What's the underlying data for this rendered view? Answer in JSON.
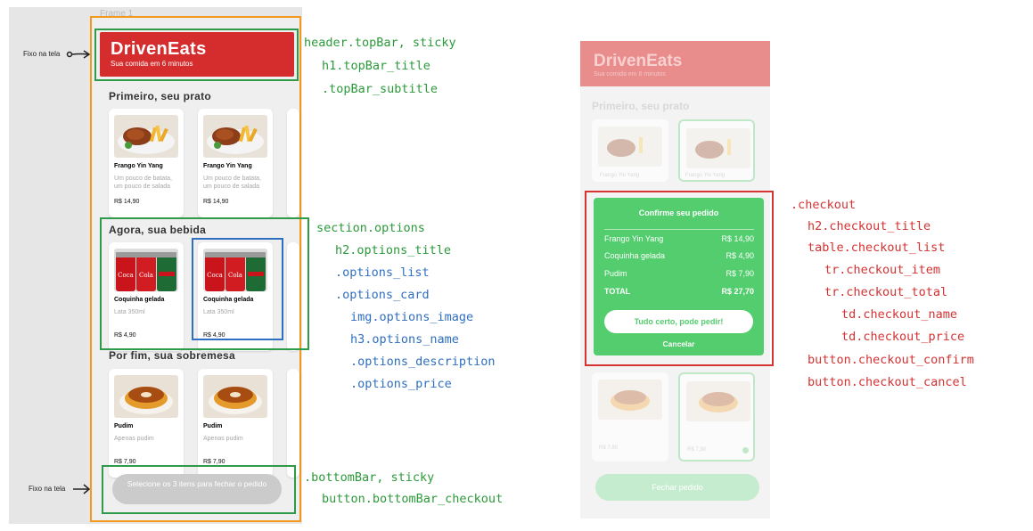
{
  "frame_label": "Frame 1",
  "pinned_label": "Fixo na tela",
  "app": {
    "title": "DrivenEats",
    "subtitle": "Sua comida em 6 minutos"
  },
  "sections": [
    {
      "title": "Primeiro, seu prato",
      "cards": [
        {
          "name": "Frango Yin Yang",
          "description": "Um pouco de batata, um pouco de salada",
          "price": "R$ 14,90",
          "image": "chicken-fries"
        },
        {
          "name": "Frango Yin Yang",
          "description": "Um pouco de batata, um pouco de salada",
          "price": "R$ 14,90",
          "image": "chicken-fries"
        }
      ]
    },
    {
      "title": "Agora, sua bebida",
      "cards": [
        {
          "name": "Coquinha gelada",
          "description": "Lata 350ml",
          "price": "R$ 4,90",
          "image": "cola-cans"
        },
        {
          "name": "Coquinha gelada",
          "description": "Lata 350ml",
          "price": "R$ 4,90",
          "image": "cola-cans"
        }
      ]
    },
    {
      "title": "Por fim, sua sobremesa",
      "cards": [
        {
          "name": "Pudim",
          "description": "Apenas pudim",
          "price": "R$ 7,90",
          "image": "flan"
        },
        {
          "name": "Pudim",
          "description": "Apenas pudim",
          "price": "R$ 7,90",
          "image": "flan"
        }
      ]
    }
  ],
  "bottom_bar": {
    "button_text": "Selecione os 3 itens para fechar o pedido"
  },
  "annotations": {
    "topbar": [
      "header.topBar, sticky",
      "h1.topBar_title",
      ".topBar_subtitle"
    ],
    "options": [
      "section.options",
      "h2.options_title",
      ".options_list",
      ".options_card",
      "img.options_image",
      "h3.options_name",
      ".options_description",
      ".options_price"
    ],
    "bottombar": [
      ".bottomBar, sticky",
      "button.bottomBar_checkout"
    ],
    "checkout": [
      ".checkout",
      "h2.checkout_title",
      "table.checkout_list",
      "tr.checkout_item",
      "tr.checkout_total",
      "td.checkout_name",
      "td.checkout_price",
      "button.checkout_confirm",
      "button.checkout_cancel"
    ]
  },
  "right_mock": {
    "app_title": "DrivenEats",
    "app_subtitle": "Sua comida em 6 minutos",
    "section_title": "Primeiro, seu prato",
    "card_names": [
      "Frango Yin Yang",
      "Frango Yin Yang"
    ],
    "dessert_prices": [
      "R$ 7,90",
      "R$ 7,90"
    ],
    "bottom_button": "Fechar pedido"
  },
  "checkout": {
    "title": "Confirme seu pedido",
    "items": [
      {
        "name": "Frango Yin Yang",
        "price": "R$ 14,90"
      },
      {
        "name": "Coquinha gelada",
        "price": "R$ 4,90"
      },
      {
        "name": "Pudim",
        "price": "R$ 7,90"
      }
    ],
    "total": {
      "name": "TOTAL",
      "price": "R$ 27,70"
    },
    "confirm_label": "Tudo certo, pode pedir!",
    "cancel_label": "Cancelar"
  },
  "colors": {
    "brand_red": "#d52d2d",
    "checkout_green": "#53cd6e",
    "annotation_green": "#2b9a3a",
    "annotation_blue": "#2f6fc0",
    "annotation_red": "#d43232",
    "frame_orange": "#f39a1d"
  }
}
